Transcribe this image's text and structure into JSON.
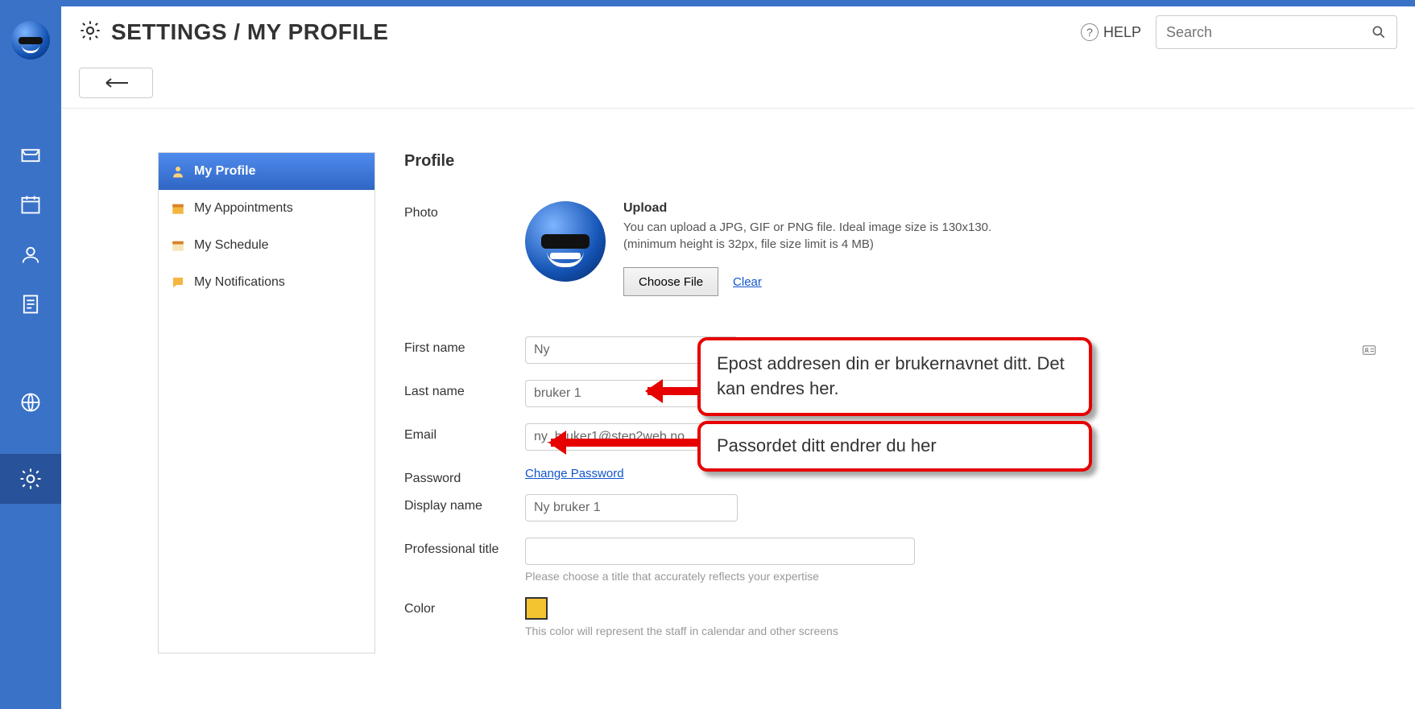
{
  "header": {
    "title": "SETTINGS / MY PROFILE",
    "help": "HELP",
    "search_placeholder": "Search"
  },
  "side_menu": {
    "items": [
      {
        "label": "My Profile",
        "active": true
      },
      {
        "label": "My Appointments"
      },
      {
        "label": "My Schedule"
      },
      {
        "label": "My Notifications"
      }
    ]
  },
  "profile": {
    "section_title": "Profile",
    "photo_label": "Photo",
    "upload_title": "Upload",
    "upload_desc_1": "You can upload a JPG, GIF or PNG file. Ideal image size is 130x130.",
    "upload_desc_2": "(minimum height is 32px, file size limit is 4 MB)",
    "choose_file": "Choose File",
    "clear": "Clear",
    "first_name_label": "First name",
    "first_name": "Ny",
    "last_name_label": "Last name",
    "last_name": "bruker 1",
    "email_label": "Email",
    "email": "ny_bruker1@step2web.no",
    "password_label": "Password",
    "change_password": "Change Password",
    "display_name_label": "Display name",
    "display_name": "Ny bruker 1",
    "prof_title_label": "Professional title",
    "prof_title": "",
    "prof_hint": "Please choose a title that accurately reflects your expertise",
    "color_label": "Color",
    "color_value": "#f4c430",
    "color_hint": "This color will represent the staff in calendar and other screens"
  },
  "annotations": {
    "email_note": "Epost addresen din er brukernavnet ditt. Det kan endres her.",
    "password_note": "Passordet ditt endrer du her"
  }
}
